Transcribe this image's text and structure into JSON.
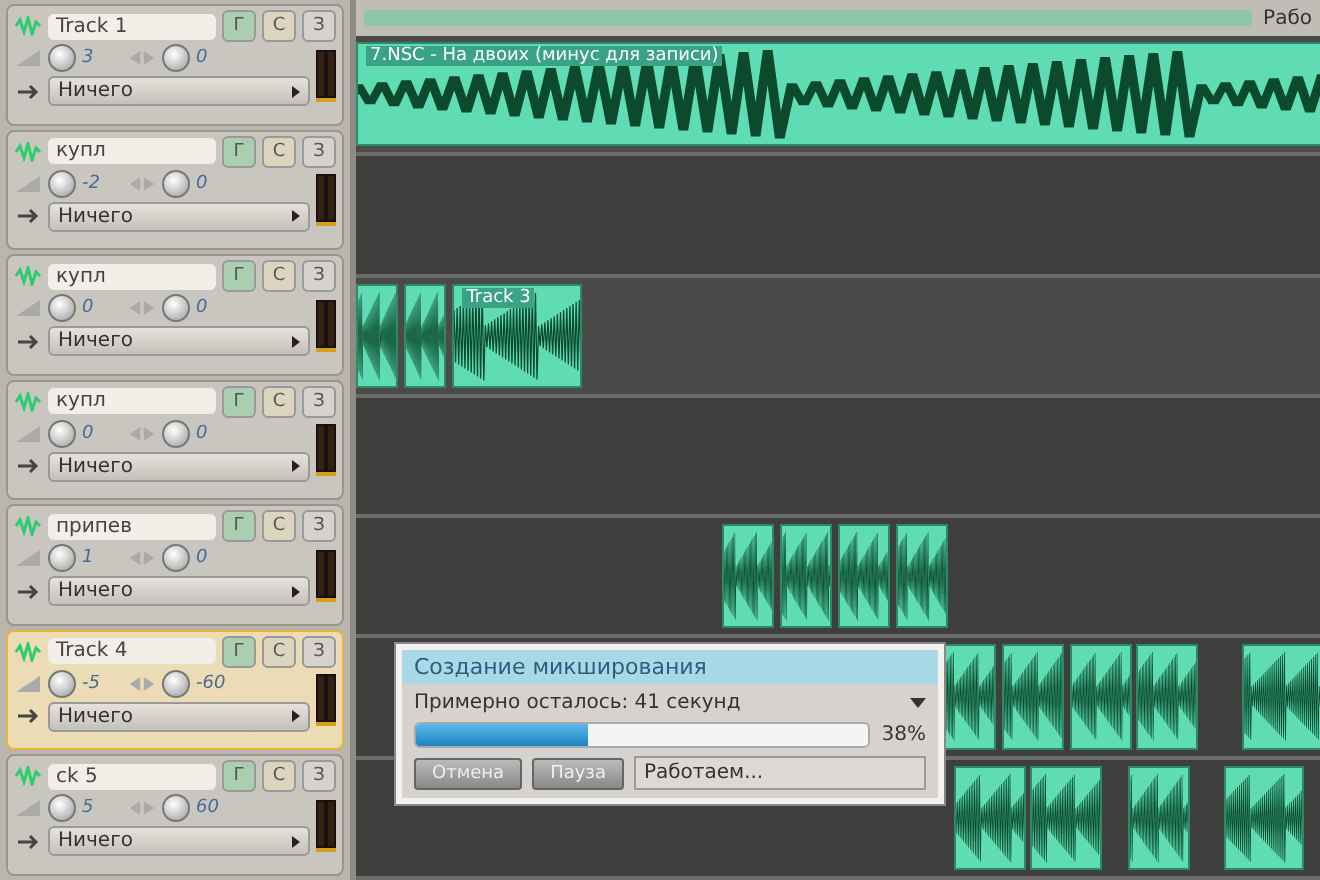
{
  "top_bar": {
    "label": "Рабо"
  },
  "tracks": [
    {
      "name": "Track 1",
      "selected": false,
      "volume": "3",
      "pan": "0",
      "output": "Ничего",
      "buttons": [
        "Г",
        "С",
        "З"
      ]
    },
    {
      "name": "купл",
      "selected": false,
      "volume": "-2",
      "pan": "0",
      "output": "Ничего",
      "buttons": [
        "Г",
        "С",
        "З"
      ]
    },
    {
      "name": "купл",
      "selected": false,
      "volume": "0",
      "pan": "0",
      "output": "Ничего",
      "buttons": [
        "Г",
        "С",
        "З"
      ]
    },
    {
      "name": "купл",
      "selected": false,
      "volume": "0",
      "pan": "0",
      "output": "Ничего",
      "buttons": [
        "Г",
        "С",
        "З"
      ]
    },
    {
      "name": "припев",
      "selected": false,
      "volume": "1",
      "pan": "0",
      "output": "Ничего",
      "buttons": [
        "Г",
        "С",
        "З"
      ]
    },
    {
      "name": "Track 4",
      "selected": true,
      "volume": "-5",
      "pan": "-60",
      "output": "Ничего",
      "buttons": [
        "Г",
        "С",
        "З"
      ]
    },
    {
      "name": "ck 5",
      "selected": false,
      "volume": "5",
      "pan": "60",
      "output": "Ничего",
      "buttons": [
        "Г",
        "С",
        "З"
      ]
    }
  ],
  "clip_titles": [
    "7.NSC - На двоих (минус для записи)",
    "Track 3"
  ],
  "dialog": {
    "title": "Создание микширования",
    "message": "Примерно осталось: 41 секунд",
    "level": 0.38,
    "percent": "38%",
    "buttons": [
      "Отмена",
      "Пауза"
    ],
    "status": "Работаем..."
  }
}
